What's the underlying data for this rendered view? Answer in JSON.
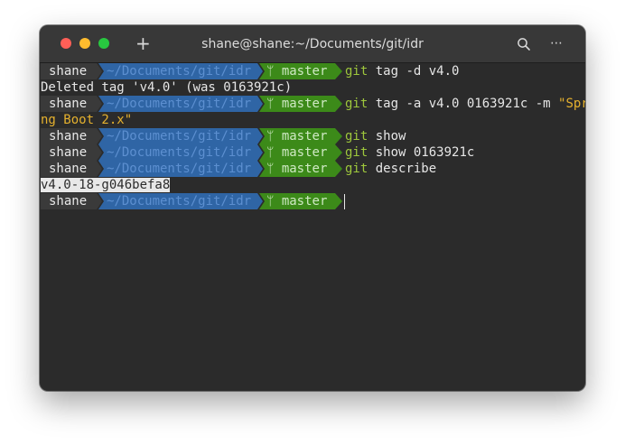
{
  "window": {
    "title": "shane@shane:~/Documents/git/idr",
    "new_tab_glyph": "+",
    "more_glyph": "⋯"
  },
  "colors": {
    "background": "#2b2b2b",
    "user_segment": "#3a3a3a",
    "path_segment": "#2f65a5",
    "branch_segment": "#3c8a19",
    "git_keyword": "#9ec73c",
    "string": "#e5b12e"
  },
  "prompt": {
    "user": "shane",
    "path": "~/Documents/git/idr",
    "branch": "ᛘ master"
  },
  "lines": [
    {
      "type": "command",
      "git": "git",
      "args": " tag -d v4.0",
      "str": ""
    },
    {
      "type": "output",
      "text": "Deleted tag 'v4.0' (was 0163921c)"
    },
    {
      "type": "command",
      "git": "git",
      "args": " tag -a v4.0 0163921c -m ",
      "str": "\"Spri"
    },
    {
      "type": "output-string",
      "text": "ng Boot 2.x\""
    },
    {
      "type": "command",
      "git": "git",
      "args": " show",
      "str": ""
    },
    {
      "type": "command",
      "git": "git",
      "args": " show 0163921c",
      "str": ""
    },
    {
      "type": "command",
      "git": "git",
      "args": " describe",
      "str": ""
    },
    {
      "type": "output-selected",
      "text": "v4.0-18-g046befa8"
    },
    {
      "type": "prompt-empty"
    }
  ]
}
